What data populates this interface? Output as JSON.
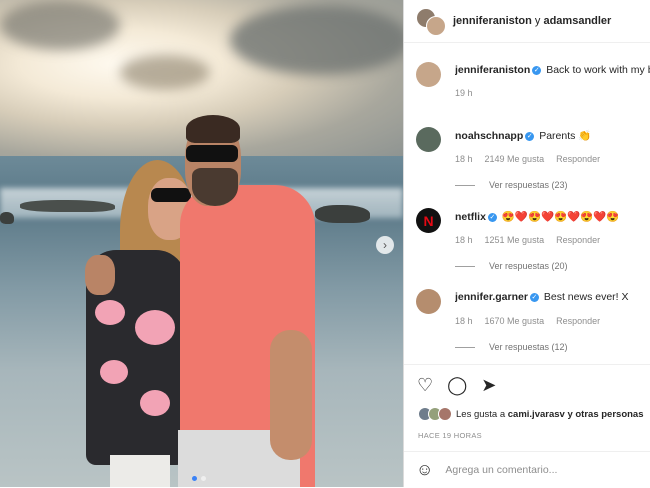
{
  "header": {
    "user1": "jenniferaniston",
    "connector": "y",
    "user2": "adamsandler"
  },
  "comments": [
    {
      "username": "jenniferaniston",
      "text": "Back to work with my b",
      "time": "19 h",
      "verified": true
    },
    {
      "username": "noahschnapp",
      "text": "Parents 👏",
      "time": "18 h",
      "likes": "2149 Me gusta",
      "reply": "Responder",
      "view_replies": "Ver respuestas (23)",
      "verified": true
    },
    {
      "username": "netflix",
      "text": "😍❤️😍❤️😍❤️😍❤️😍",
      "time": "18 h",
      "likes": "1251 Me gusta",
      "reply": "Responder",
      "view_replies": "Ver respuestas (20)",
      "verified": true
    },
    {
      "username": "jennifer.garner",
      "text": "Best news ever! X",
      "time": "18 h",
      "likes": "1670 Me gusta",
      "reply": "Responder",
      "view_replies": "Ver respuestas (12)",
      "verified": true
    }
  ],
  "actions": {
    "likes_prefix": "Les gusta a",
    "likes_user": "cami.jvarasv",
    "likes_suffix": "y otras personas",
    "time_ago": "HACE 19 HORAS"
  },
  "add_comment": {
    "placeholder": "Agrega un comentario..."
  },
  "icons": {
    "like": "heart-icon",
    "comment": "comment-icon",
    "share": "share-icon",
    "emoji": "emoji-icon",
    "next": "chevron-right-icon"
  },
  "colors": {
    "verified": "#3897f0",
    "shirt": "#f0786d",
    "netflix": "#e50914"
  }
}
